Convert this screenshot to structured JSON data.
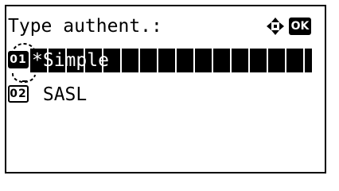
{
  "screen": {
    "title": "Type authent.:",
    "nav_icon": "four-way-arrow-icon",
    "ok_label": "OK"
  },
  "options": [
    {
      "number": "01",
      "label": "*Simple",
      "selected": true
    },
    {
      "number": "02",
      "label": " SASL",
      "selected": false
    }
  ],
  "colors": {
    "foreground": "#000000",
    "background": "#ffffff"
  }
}
